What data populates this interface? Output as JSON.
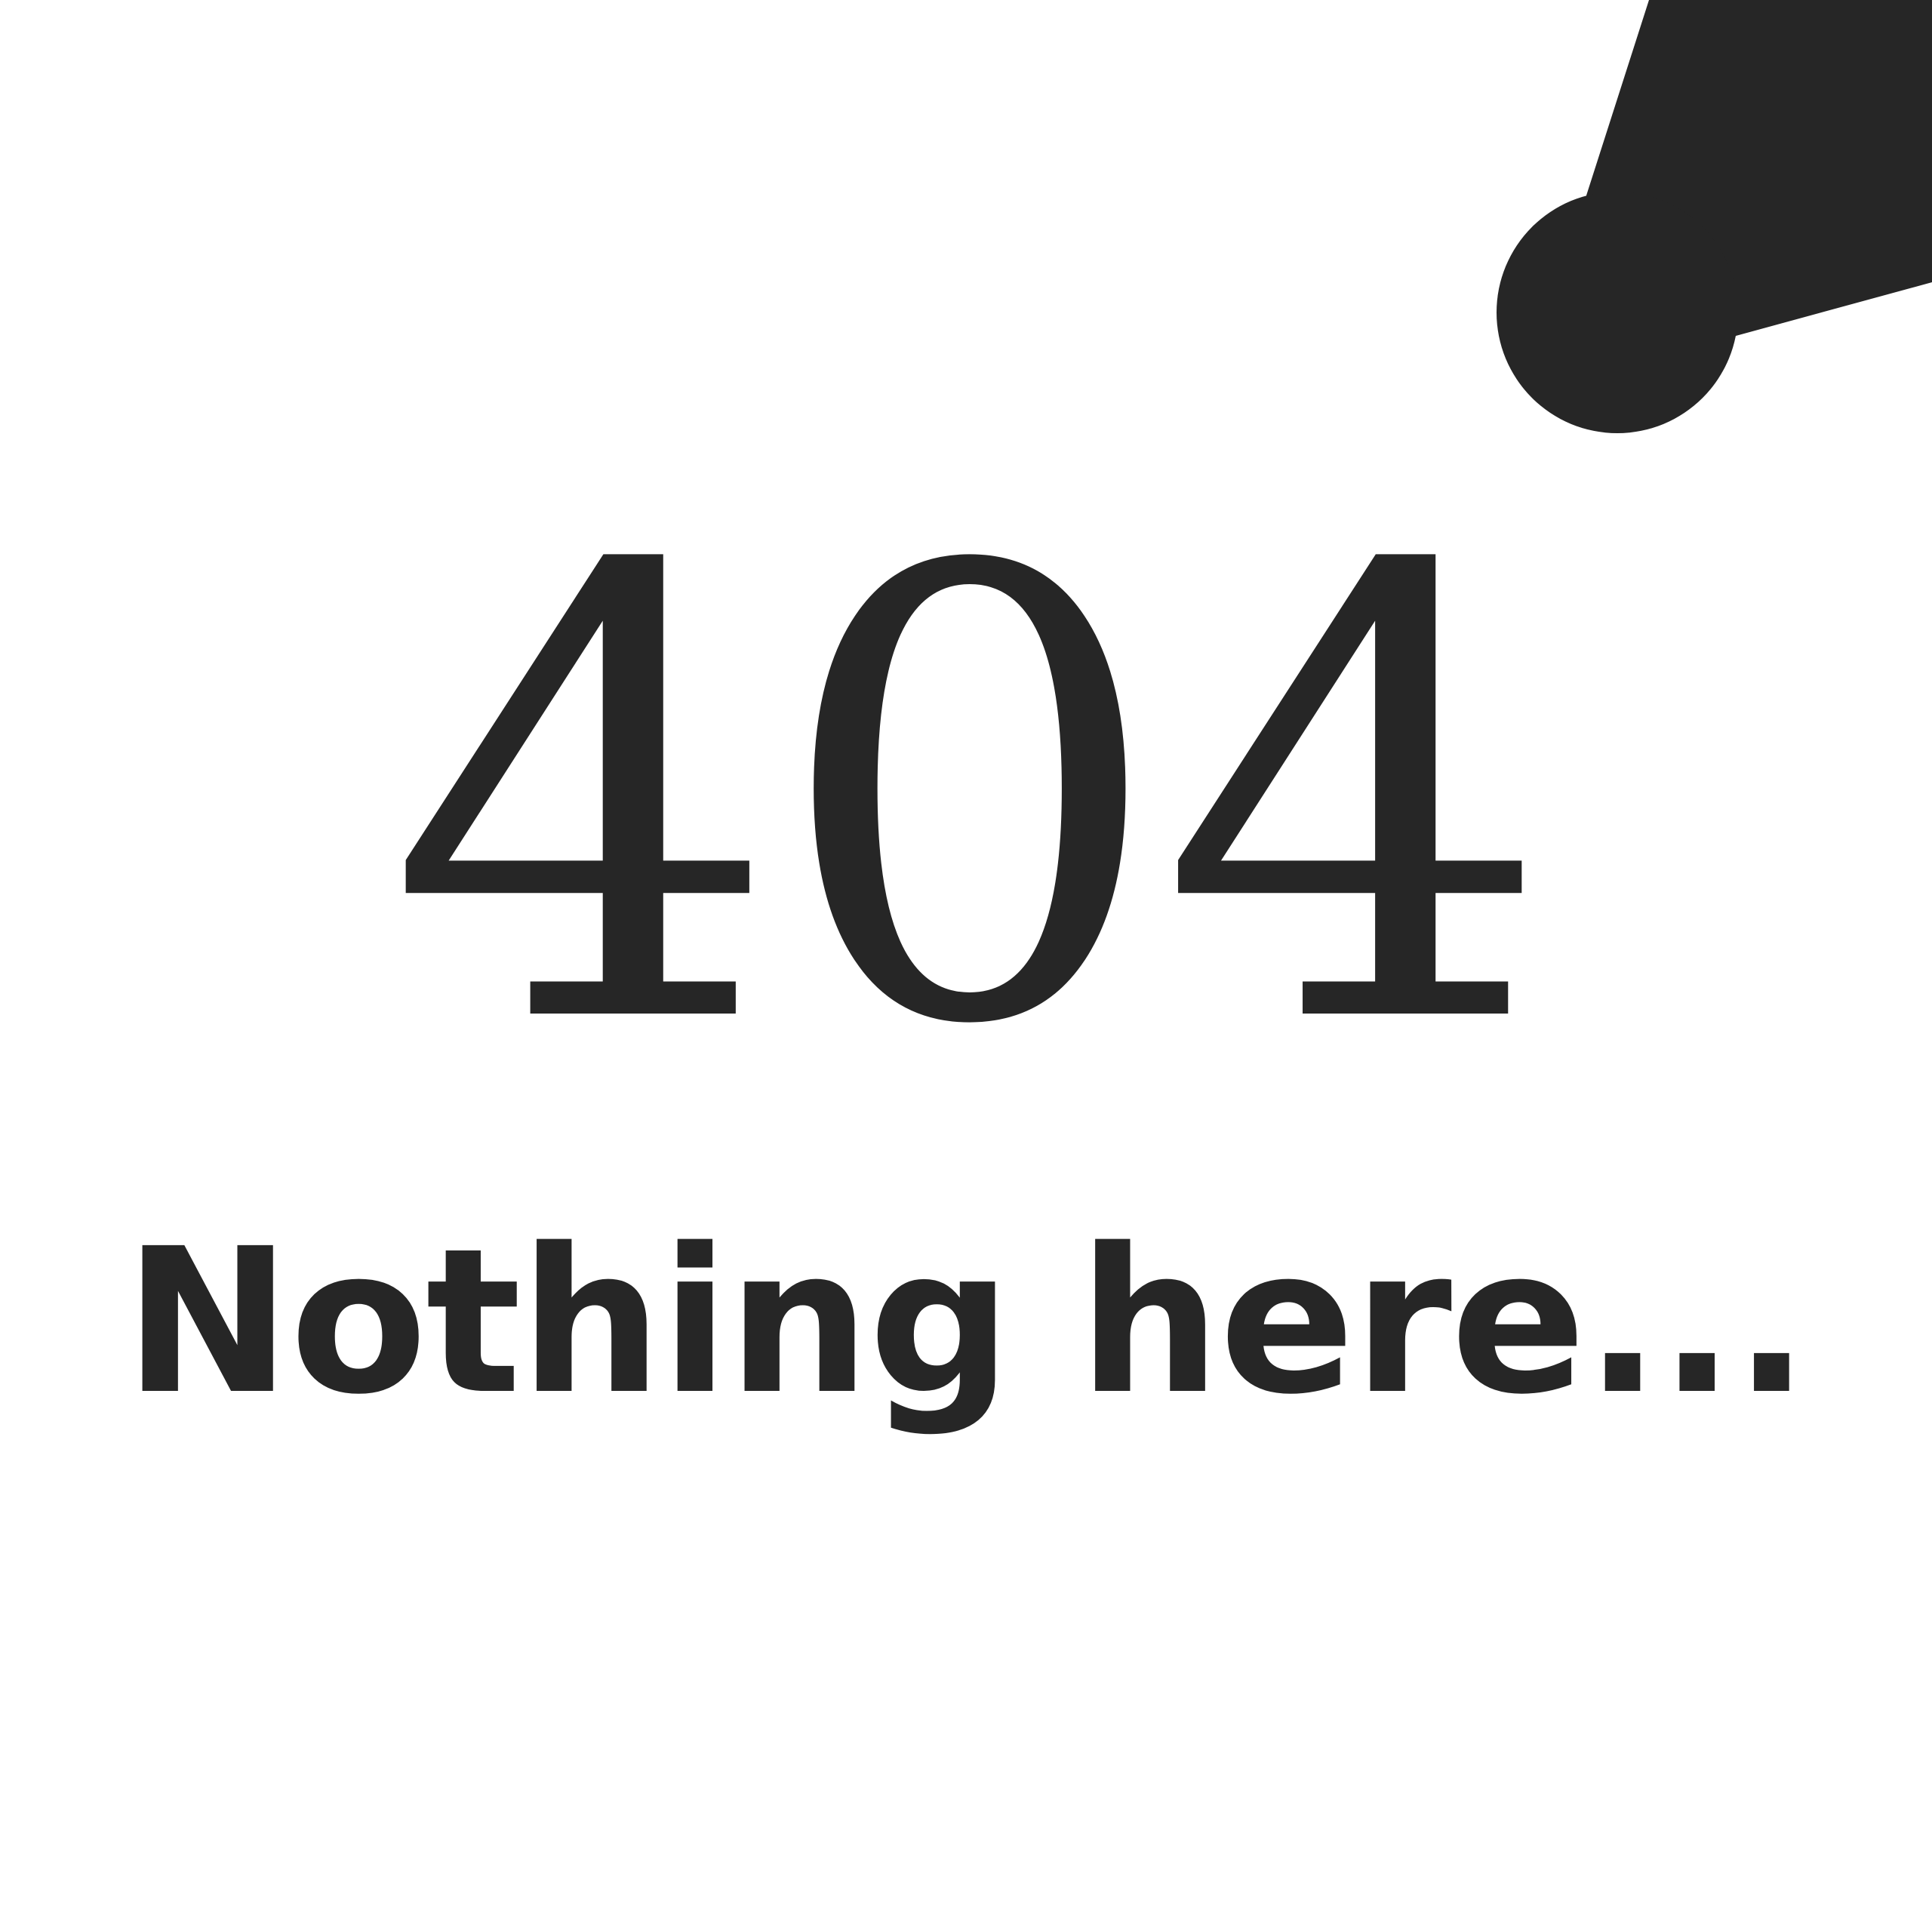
{
  "error": {
    "code": "404",
    "message": "Nothing here..."
  },
  "graphic": {
    "icon": "map-pin-icon",
    "color": "#262626"
  },
  "colors": {
    "background": "#ffffff",
    "text": "#262626"
  }
}
